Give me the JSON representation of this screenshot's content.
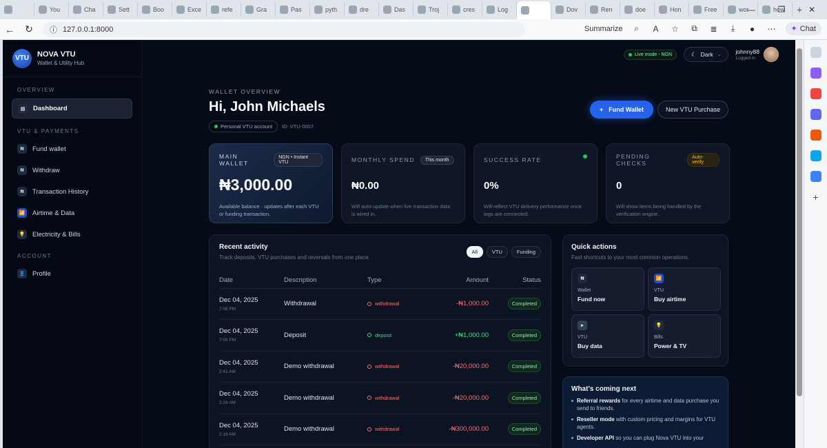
{
  "browser": {
    "tabs": [
      {
        "label": "You"
      },
      {
        "label": "Cha"
      },
      {
        "label": "Sett"
      },
      {
        "label": "Boo"
      },
      {
        "label": "Exce"
      },
      {
        "label": "refe"
      },
      {
        "label": "Gra"
      },
      {
        "label": "Pas"
      },
      {
        "label": "pyth"
      },
      {
        "label": "dre"
      },
      {
        "label": "Das"
      },
      {
        "label": "Troj"
      },
      {
        "label": "cres"
      },
      {
        "label": "Log"
      },
      {
        "label": ""
      },
      {
        "label": "Dov"
      },
      {
        "label": "Ren"
      },
      {
        "label": "doe"
      },
      {
        "label": "Hon"
      },
      {
        "label": "Free"
      },
      {
        "label": "wor"
      },
      {
        "label": "how"
      }
    ],
    "url": "127.0.0.1:8000",
    "summarize_label": "Summarize",
    "chat_label": "Chat"
  },
  "brand": {
    "logo": "VTU",
    "name": "NOVA VTU",
    "tagline": "Wallet & Utility Hub"
  },
  "sidebar": {
    "sections": {
      "overview": "OVERVIEW",
      "vtu": "VTU & PAYMENTS",
      "account": "ACCOUNT"
    },
    "items": [
      {
        "label": "Dashboard",
        "icon": "▤"
      },
      {
        "label": "Fund wallet",
        "icon": "₦"
      },
      {
        "label": "Withdraw",
        "icon": "₦"
      },
      {
        "label": "Transaction History",
        "icon": "₦"
      },
      {
        "label": "Airtime & Data",
        "icon": "📶"
      },
      {
        "label": "Electricity & Bills",
        "icon": "💡"
      },
      {
        "label": "Profile",
        "icon": "👤"
      }
    ]
  },
  "topbar": {
    "live_mode": "Live mode - NGN",
    "theme": "Dark",
    "username": "johnny88",
    "user_status": "Logged in"
  },
  "header": {
    "eyebrow": "WALLET OVERVIEW",
    "greeting": "Hi, John Michaels",
    "account_type": "Personal VTU account",
    "account_id": "ID: VTU-0007",
    "fund_button": "Fund Wallet",
    "new_purchase_button": "New VTU Purchase"
  },
  "stats": [
    {
      "label": "MAIN WALLET",
      "tag": "NGN • Instant VTU",
      "value": "₦3,000.00",
      "desc": "Available balance · updates after each VTU or funding transaction."
    },
    {
      "label": "MONTHLY SPEND",
      "tag": "This month",
      "value": "₦0.00",
      "desc": "Will auto-update when live transaction data is wired in."
    },
    {
      "label": "SUCCESS RATE",
      "tag": "",
      "value": "0%",
      "desc": "Will reflect VTU delivery performance once logs are connected."
    },
    {
      "label": "PENDING CHECKS",
      "tag": "Auto-verify",
      "value": "0",
      "desc": "Will show items being handled by the verification engine."
    }
  ],
  "activity": {
    "title": "Recent activity",
    "subtitle": "Track deposits, VTU purchases and reversals from one place.",
    "filters": [
      "All",
      "VTU",
      "Funding"
    ],
    "columns": [
      "Date",
      "Description",
      "Type",
      "Amount",
      "Status"
    ],
    "rows": [
      {
        "date": "Dec 04, 2025",
        "time": "7:08 PM",
        "desc": "Withdrawal",
        "type": "withdrawal",
        "amount": "-₦1,000.00",
        "status": "Completed"
      },
      {
        "date": "Dec 04, 2025",
        "time": "7:06 PM",
        "desc": "Deposit",
        "type": "deposit",
        "amount": "+₦1,000.00",
        "status": "Completed"
      },
      {
        "date": "Dec 04, 2025",
        "time": "2:41 AM",
        "desc": "Demo withdrawal",
        "type": "withdrawal",
        "amount": "-₦20,000.00",
        "status": "Completed"
      },
      {
        "date": "Dec 04, 2025",
        "time": "2:24 AM",
        "desc": "Demo withdrawal",
        "type": "withdrawal",
        "amount": "-₦20,000.00",
        "status": "Completed"
      },
      {
        "date": "Dec 04, 2025",
        "time": "2:18 AM",
        "desc": "Demo withdrawal",
        "type": "withdrawal",
        "amount": "-₦300,000.00",
        "status": "Completed"
      }
    ]
  },
  "quick_actions": {
    "title": "Quick actions",
    "subtitle": "Fast shortcuts to your most common operations.",
    "items": [
      {
        "icon": "₦",
        "small": "Wallet",
        "big": "Fund now"
      },
      {
        "icon": "📶",
        "small": "VTU",
        "big": "Buy airtime"
      },
      {
        "icon": "▸",
        "small": "VTU",
        "big": "Buy data"
      },
      {
        "icon": "💡",
        "small": "Bills",
        "big": "Power & TV"
      }
    ]
  },
  "coming_next": {
    "title": "What's coming next",
    "items": [
      {
        "bold": "Referral rewards",
        "text": " for every airtime and data purchase you send to friends."
      },
      {
        "bold": "Reseller mode",
        "text": " with custom pricing and margins for VTU agents."
      },
      {
        "bold": "Developer API",
        "text": " so you can plug Nova VTU into your"
      }
    ]
  }
}
